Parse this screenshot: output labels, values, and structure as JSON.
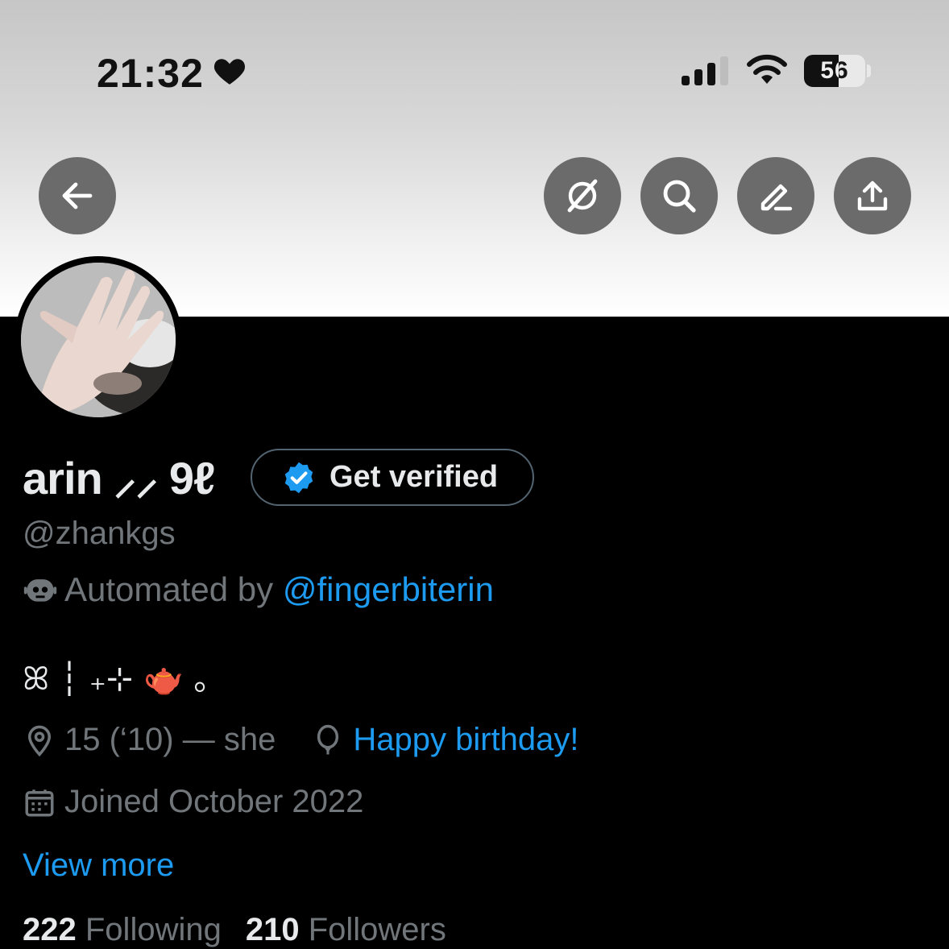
{
  "status_bar": {
    "time": "21:32",
    "battery_level": "56",
    "battery_fraction": 0.56
  },
  "header": {
    "back_icon": "arrow-left-icon",
    "actions": [
      "grok-icon",
      "search-icon",
      "edit-icon",
      "share-icon"
    ]
  },
  "profile": {
    "display_name": "arin ⸝⸝ 9ℓ",
    "verify_label": "Get verified",
    "handle": "@zhankgs",
    "automated_prefix": "Automated by ",
    "automated_link": "@fingerbiterin",
    "bio": "ꕤ ┆ ₊⊹ 🫖 ｡",
    "location": "15 (‘10) — she",
    "birthday": "Happy birthday!",
    "joined": "Joined October 2022",
    "view_more": "View more",
    "following_count": "222",
    "following_label": "Following",
    "followers_count": "210",
    "followers_label": "Followers"
  },
  "colors": {
    "accent": "#1d9bf0",
    "muted": "#71767b",
    "text": "#e7e9ea",
    "background": "#000000",
    "header_button": "#6b6b6b"
  }
}
